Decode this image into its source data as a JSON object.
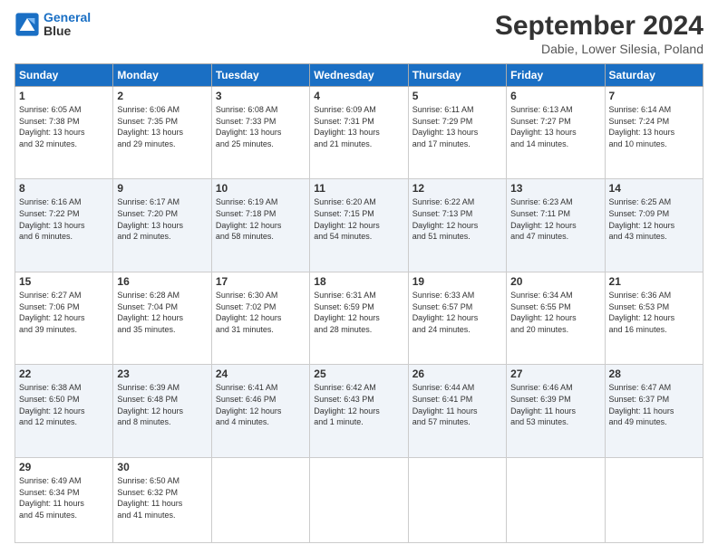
{
  "logo": {
    "line1": "General",
    "line2": "Blue"
  },
  "title": "September 2024",
  "location": "Dabie, Lower Silesia, Poland",
  "days_of_week": [
    "Sunday",
    "Monday",
    "Tuesday",
    "Wednesday",
    "Thursday",
    "Friday",
    "Saturday"
  ],
  "weeks": [
    [
      {
        "day": "1",
        "info": "Sunrise: 6:05 AM\nSunset: 7:38 PM\nDaylight: 13 hours\nand 32 minutes."
      },
      {
        "day": "2",
        "info": "Sunrise: 6:06 AM\nSunset: 7:35 PM\nDaylight: 13 hours\nand 29 minutes."
      },
      {
        "day": "3",
        "info": "Sunrise: 6:08 AM\nSunset: 7:33 PM\nDaylight: 13 hours\nand 25 minutes."
      },
      {
        "day": "4",
        "info": "Sunrise: 6:09 AM\nSunset: 7:31 PM\nDaylight: 13 hours\nand 21 minutes."
      },
      {
        "day": "5",
        "info": "Sunrise: 6:11 AM\nSunset: 7:29 PM\nDaylight: 13 hours\nand 17 minutes."
      },
      {
        "day": "6",
        "info": "Sunrise: 6:13 AM\nSunset: 7:27 PM\nDaylight: 13 hours\nand 14 minutes."
      },
      {
        "day": "7",
        "info": "Sunrise: 6:14 AM\nSunset: 7:24 PM\nDaylight: 13 hours\nand 10 minutes."
      }
    ],
    [
      {
        "day": "8",
        "info": "Sunrise: 6:16 AM\nSunset: 7:22 PM\nDaylight: 13 hours\nand 6 minutes."
      },
      {
        "day": "9",
        "info": "Sunrise: 6:17 AM\nSunset: 7:20 PM\nDaylight: 13 hours\nand 2 minutes."
      },
      {
        "day": "10",
        "info": "Sunrise: 6:19 AM\nSunset: 7:18 PM\nDaylight: 12 hours\nand 58 minutes."
      },
      {
        "day": "11",
        "info": "Sunrise: 6:20 AM\nSunset: 7:15 PM\nDaylight: 12 hours\nand 54 minutes."
      },
      {
        "day": "12",
        "info": "Sunrise: 6:22 AM\nSunset: 7:13 PM\nDaylight: 12 hours\nand 51 minutes."
      },
      {
        "day": "13",
        "info": "Sunrise: 6:23 AM\nSunset: 7:11 PM\nDaylight: 12 hours\nand 47 minutes."
      },
      {
        "day": "14",
        "info": "Sunrise: 6:25 AM\nSunset: 7:09 PM\nDaylight: 12 hours\nand 43 minutes."
      }
    ],
    [
      {
        "day": "15",
        "info": "Sunrise: 6:27 AM\nSunset: 7:06 PM\nDaylight: 12 hours\nand 39 minutes."
      },
      {
        "day": "16",
        "info": "Sunrise: 6:28 AM\nSunset: 7:04 PM\nDaylight: 12 hours\nand 35 minutes."
      },
      {
        "day": "17",
        "info": "Sunrise: 6:30 AM\nSunset: 7:02 PM\nDaylight: 12 hours\nand 31 minutes."
      },
      {
        "day": "18",
        "info": "Sunrise: 6:31 AM\nSunset: 6:59 PM\nDaylight: 12 hours\nand 28 minutes."
      },
      {
        "day": "19",
        "info": "Sunrise: 6:33 AM\nSunset: 6:57 PM\nDaylight: 12 hours\nand 24 minutes."
      },
      {
        "day": "20",
        "info": "Sunrise: 6:34 AM\nSunset: 6:55 PM\nDaylight: 12 hours\nand 20 minutes."
      },
      {
        "day": "21",
        "info": "Sunrise: 6:36 AM\nSunset: 6:53 PM\nDaylight: 12 hours\nand 16 minutes."
      }
    ],
    [
      {
        "day": "22",
        "info": "Sunrise: 6:38 AM\nSunset: 6:50 PM\nDaylight: 12 hours\nand 12 minutes."
      },
      {
        "day": "23",
        "info": "Sunrise: 6:39 AM\nSunset: 6:48 PM\nDaylight: 12 hours\nand 8 minutes."
      },
      {
        "day": "24",
        "info": "Sunrise: 6:41 AM\nSunset: 6:46 PM\nDaylight: 12 hours\nand 4 minutes."
      },
      {
        "day": "25",
        "info": "Sunrise: 6:42 AM\nSunset: 6:43 PM\nDaylight: 12 hours\nand 1 minute."
      },
      {
        "day": "26",
        "info": "Sunrise: 6:44 AM\nSunset: 6:41 PM\nDaylight: 11 hours\nand 57 minutes."
      },
      {
        "day": "27",
        "info": "Sunrise: 6:46 AM\nSunset: 6:39 PM\nDaylight: 11 hours\nand 53 minutes."
      },
      {
        "day": "28",
        "info": "Sunrise: 6:47 AM\nSunset: 6:37 PM\nDaylight: 11 hours\nand 49 minutes."
      }
    ],
    [
      {
        "day": "29",
        "info": "Sunrise: 6:49 AM\nSunset: 6:34 PM\nDaylight: 11 hours\nand 45 minutes."
      },
      {
        "day": "30",
        "info": "Sunrise: 6:50 AM\nSunset: 6:32 PM\nDaylight: 11 hours\nand 41 minutes."
      },
      {
        "day": "",
        "info": ""
      },
      {
        "day": "",
        "info": ""
      },
      {
        "day": "",
        "info": ""
      },
      {
        "day": "",
        "info": ""
      },
      {
        "day": "",
        "info": ""
      }
    ]
  ]
}
